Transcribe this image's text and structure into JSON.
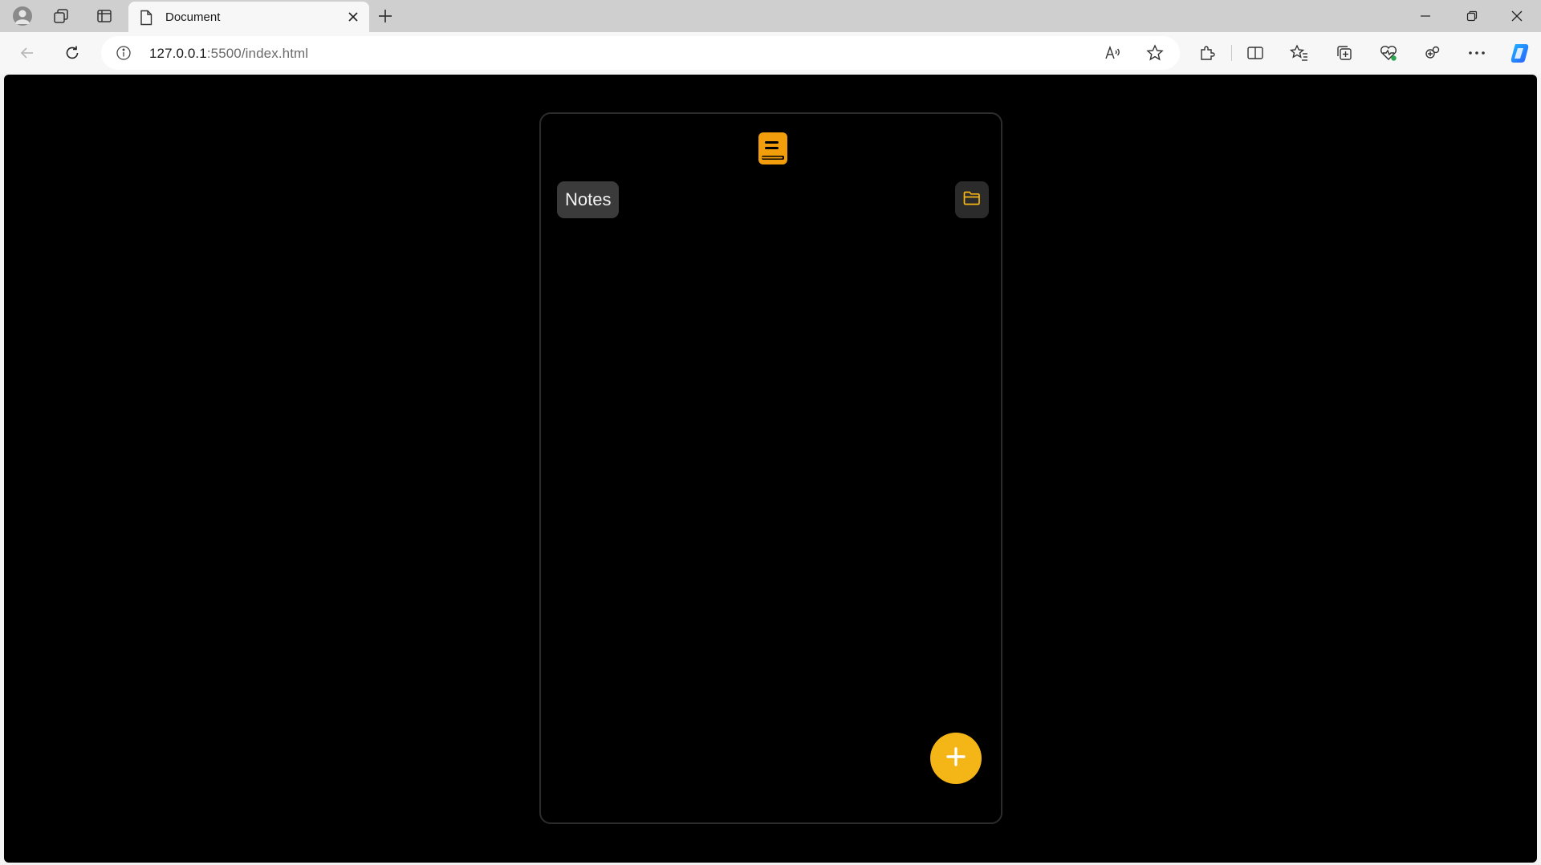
{
  "browser": {
    "tab": {
      "title": "Document",
      "icon": "document-icon"
    },
    "address": {
      "host": "127.0.0.1",
      "rest": ":5500/index.html"
    }
  },
  "app": {
    "header": {
      "title": "Notes",
      "logo": "book-icon",
      "folder_icon": "folder-icon"
    },
    "fab": {
      "icon": "plus-icon"
    },
    "colors": {
      "accent": "#F4B516",
      "logo": "#F29E0C",
      "background": "#000000",
      "title_bg": "#3B3B3B",
      "card_border": "#2C2C2C"
    }
  }
}
